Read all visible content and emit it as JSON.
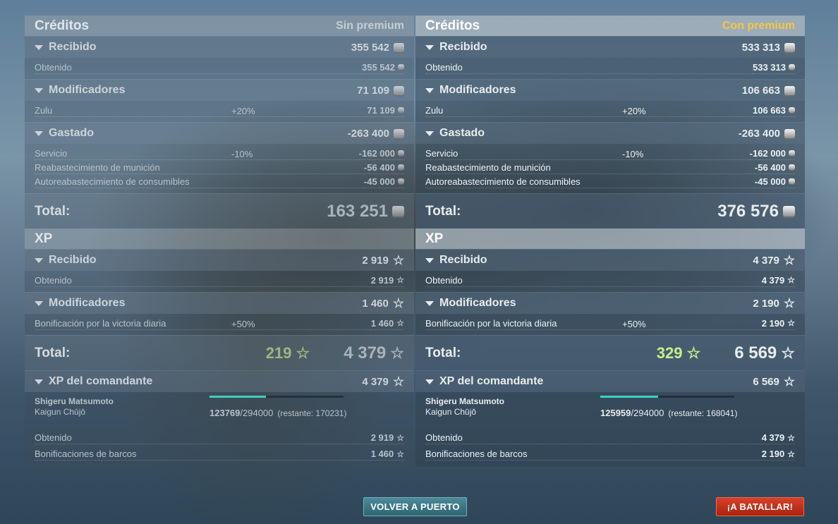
{
  "left": {
    "credits": {
      "title": "Créditos",
      "tag": "Sin premium",
      "received": {
        "label": "Recibido",
        "value": "355 542"
      },
      "received_rows": [
        {
          "name": "Obtenido",
          "pct": "",
          "value": "355 542"
        }
      ],
      "modifiers": {
        "label": "Modificadores",
        "value": "71 109"
      },
      "modifier_rows": [
        {
          "name": "Zulu",
          "pct": "+20%",
          "value": "71 109"
        }
      ],
      "spent": {
        "label": "Gastado",
        "value": "-263 400"
      },
      "spent_rows": [
        {
          "name": "Servicio",
          "pct": "-10%",
          "value": "-162 000"
        },
        {
          "name": "Reabastecimiento de munición",
          "pct": "",
          "value": "-56 400"
        },
        {
          "name": "Autoreabastecimiento de consumibles",
          "pct": "",
          "value": "-45 000"
        }
      ],
      "total_label": "Total:",
      "total": "163 251"
    },
    "xp": {
      "title": "XP",
      "received": {
        "label": "Recibido",
        "value": "2 919"
      },
      "received_rows": [
        {
          "name": "Obtenido",
          "pct": "",
          "value": "2 919"
        }
      ],
      "modifiers": {
        "label": "Modificadores",
        "value": "1 460"
      },
      "modifier_rows": [
        {
          "name": "Bonificación por la victoria diaria",
          "pct": "+50%",
          "value": "1 460"
        }
      ],
      "total_label": "Total:",
      "total_free": "219",
      "total": "4 379"
    },
    "commander": {
      "label": "XP del comandante",
      "value": "4 379",
      "name": "Shigeru Matsumoto",
      "rank": "Kaigun Chūjō",
      "progress_current": "123769",
      "progress_max": "/294000",
      "remaining": "(restante: 170231)",
      "progress_fraction": 0.42,
      "rows": [
        {
          "name": "Obtenido",
          "value": "2 919"
        },
        {
          "name": "Bonificaciones de barcos",
          "value": "1 460"
        }
      ]
    }
  },
  "right": {
    "credits": {
      "title": "Créditos",
      "tag": "Con premium",
      "received": {
        "label": "Recibido",
        "value": "533 313"
      },
      "received_rows": [
        {
          "name": "Obtenido",
          "pct": "",
          "value": "533 313"
        }
      ],
      "modifiers": {
        "label": "Modificadores",
        "value": "106 663"
      },
      "modifier_rows": [
        {
          "name": "Zulu",
          "pct": "+20%",
          "value": "106 663"
        }
      ],
      "spent": {
        "label": "Gastado",
        "value": "-263 400"
      },
      "spent_rows": [
        {
          "name": "Servicio",
          "pct": "-10%",
          "value": "-162 000"
        },
        {
          "name": "Reabastecimiento de munición",
          "pct": "",
          "value": "-56 400"
        },
        {
          "name": "Autoreabastecimiento de consumibles",
          "pct": "",
          "value": "-45 000"
        }
      ],
      "total_label": "Total:",
      "total": "376 576"
    },
    "xp": {
      "title": "XP",
      "received": {
        "label": "Recibido",
        "value": "4 379"
      },
      "received_rows": [
        {
          "name": "Obtenido",
          "pct": "",
          "value": "4 379"
        }
      ],
      "modifiers": {
        "label": "Modificadores",
        "value": "2 190"
      },
      "modifier_rows": [
        {
          "name": "Bonificación por la victoria diaria",
          "pct": "+50%",
          "value": "2 190"
        }
      ],
      "total_label": "Total:",
      "total_free": "329",
      "total": "6 569"
    },
    "commander": {
      "label": "XP del comandante",
      "value": "6 569",
      "name": "Shigeru Matsumoto",
      "rank": "Kaigun Chūjō",
      "progress_current": "125959",
      "progress_max": "/294000",
      "remaining": "(restante: 168041)",
      "progress_fraction": 0.43,
      "rows": [
        {
          "name": "Obtenido",
          "value": "4 379"
        },
        {
          "name": "Bonificaciones de barcos",
          "value": "2 190"
        }
      ]
    }
  },
  "buttons": {
    "port": "VOLVER A PUERTO",
    "battle": "¡A BATALLAR!"
  },
  "colors": {
    "premium_tag": "#f4c842",
    "free_xp_green": "#c7f08a",
    "progress_fill": "#3fd0c0",
    "battle_button": "#c8321c",
    "port_button": "#3e7a88"
  }
}
